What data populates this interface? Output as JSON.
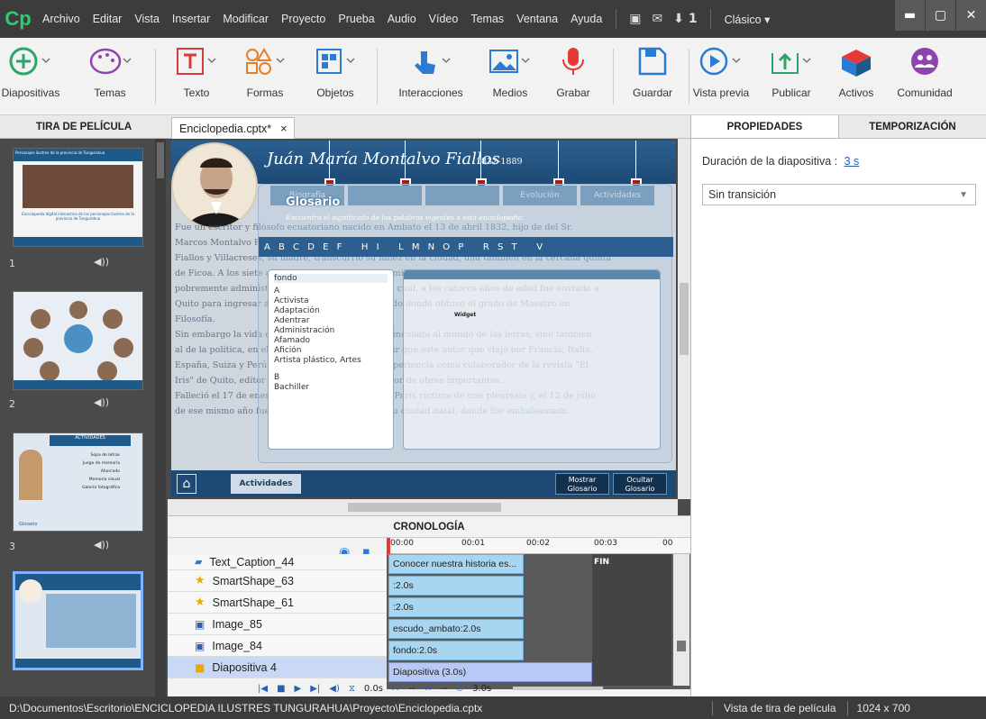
{
  "app": {
    "logo": "Cp"
  },
  "menu": [
    "Archivo",
    "Editar",
    "Vista",
    "Insertar",
    "Modificar",
    "Proyecto",
    "Prueba",
    "Audio",
    "Vídeo",
    "Temas",
    "Ventana",
    "Ayuda"
  ],
  "menu_right": {
    "notify_count": "1",
    "workspace": "Clásico"
  },
  "toolbar": {
    "diapositivas": "Diapositivas",
    "temas": "Temas",
    "texto": "Texto",
    "formas": "Formas",
    "objetos": "Objetos",
    "interacciones": "Interacciones",
    "medios": "Medios",
    "grabar": "Grabar",
    "guardar": "Guardar",
    "vista_previa": "Vista previa",
    "publicar": "Publicar",
    "activos": "Activos",
    "comunidad": "Comunidad"
  },
  "filmstrip": {
    "title": "TIRA DE PELÍCULA",
    "slides": [
      {
        "num": "1",
        "caption_a": "Personajes ilustres de la provincia de Tungurahua",
        "caption_b": "Enciclopedia digital interactiva de los personajes ilustres de la provincia de Tungurahua"
      },
      {
        "num": "2"
      },
      {
        "num": "3",
        "caption_a": "ACTIVIDADES",
        "items": [
          "Sopa de letras",
          "Juego de memoria",
          "Ahorcado",
          "Memoria visual",
          "Galería fotográfica"
        ],
        "footer": "Glosario"
      },
      {
        "num": "4"
      }
    ]
  },
  "doc": {
    "tab_title": "Enciclopedia.cptx*",
    "close": "×"
  },
  "slide": {
    "title": "Juán María Montalvo Fiallos",
    "years": "1832-1889",
    "tabs": [
      "Biografía",
      "",
      "",
      "Evolución",
      "Actividades"
    ],
    "glosario_title": "Glosario",
    "glosario_subtitle": "Encuentra el significado de las palabras vigentes a esta enciclopedia.",
    "alphabet": "A B C D E F   H I   L M N O P   R S T   V",
    "bio_lines": [
      "Fue un escritor y filósofo ecuatoriano nacido en Ambato el 13 de abril 1832, hijo de del Sr.",
      "Marcos Montalvo Fiallos, de una ascendencia distinguida en la ciudad, y de la Sra. María Josefa",
      "Fiallos y Villacreses, su madre, transcurrió su niñez en la ciudad, una también en la cercana quinta",
      "de Ficoa. A los siete años fue a la escuela, una humilde casa de aldea, de una sola planta,",
      "pobremente administrada y sostenida, luego de lo cual, a los catorce años de edad fue enviado a",
      "Quito para ingresar al Convictorio de San Fernando donde obtuvo el grado de Maestro en",
      "Filosofía.",
      "Sin embargo la vida de Montalvo no sólo estuvo vinculada al mundo de las letras, sino también",
      "al de la política, en el plano literario, hay que decir que este autor que viajó por Francia, Italia,",
      "España, Suiza y Perú, entre otros países, sumó experiencia como colaborador de la revista \"El",
      "Iris\" de Quito, editor de \"El Cosmopolita\", y creador de obras importantes.",
      "Falleció el 17 de enero de 1889, a los 56 años, en París víctima de una pleuresía y, el 12 de julio",
      "de ese mismo año fueron repatriados a Ambato, su ciudad natal, donde fue embalsamado."
    ],
    "glossary_list": [
      "fondo",
      "A",
      "Activista",
      "Adaptación",
      "Adentrar",
      "Administración",
      "Afamado",
      "Afición",
      "Artista plástico, Artes",
      "B",
      "Bachiller"
    ],
    "widget_label": "Widget",
    "actividades_btn": "Actividades",
    "mostrar_btn": "Mostrar Glosario",
    "ocultar_btn": "Ocultar Glosario"
  },
  "right_panel": {
    "tabs": [
      "PROPIEDADES",
      "TEMPORIZACIÓN"
    ],
    "duracion_label": "Duración de la diapositiva :",
    "duracion_value": "3 s",
    "transition": "Sin transición"
  },
  "timeline": {
    "title": "CRONOLOGÍA",
    "ticks": [
      "00:00",
      "00:01",
      "00:02",
      "00:03",
      "00"
    ],
    "fin": "FIN",
    "rows": [
      {
        "name": "Text_Caption_44",
        "icon": "caption-icon",
        "bar": "Conocer nuestra historia es..."
      },
      {
        "name": "SmartShape_63",
        "icon": "star-icon",
        "bar": ":2.0s"
      },
      {
        "name": "SmartShape_61",
        "icon": "star-icon",
        "bar": ":2.0s"
      },
      {
        "name": "Image_85",
        "icon": "image-icon",
        "bar": "escudo_ambato:2.0s"
      },
      {
        "name": "Image_84",
        "icon": "image-icon",
        "bar": "fondo:2.0s"
      },
      {
        "name": "Diapositiva 4",
        "icon": "slide-icon",
        "bar": "Diapositiva (3.0s)"
      }
    ],
    "controls": {
      "time": "0.0s",
      "in": "--",
      "dur": "--",
      "total": "3.0s"
    }
  },
  "status": {
    "path": "D:\\Documentos\\Escritorio\\ENCICLOPEDIA ILUSTRES TUNGURAHUA\\Proyecto\\Enciclopedia.cptx",
    "view": "Vista de tira de película",
    "size": "1024 x 700"
  },
  "colors": {
    "accent_green": "#2ecc71",
    "slide_blue": "#1d5a8a",
    "timeline_bar": "#a8d5f0",
    "selection": "#7fb2ff"
  }
}
